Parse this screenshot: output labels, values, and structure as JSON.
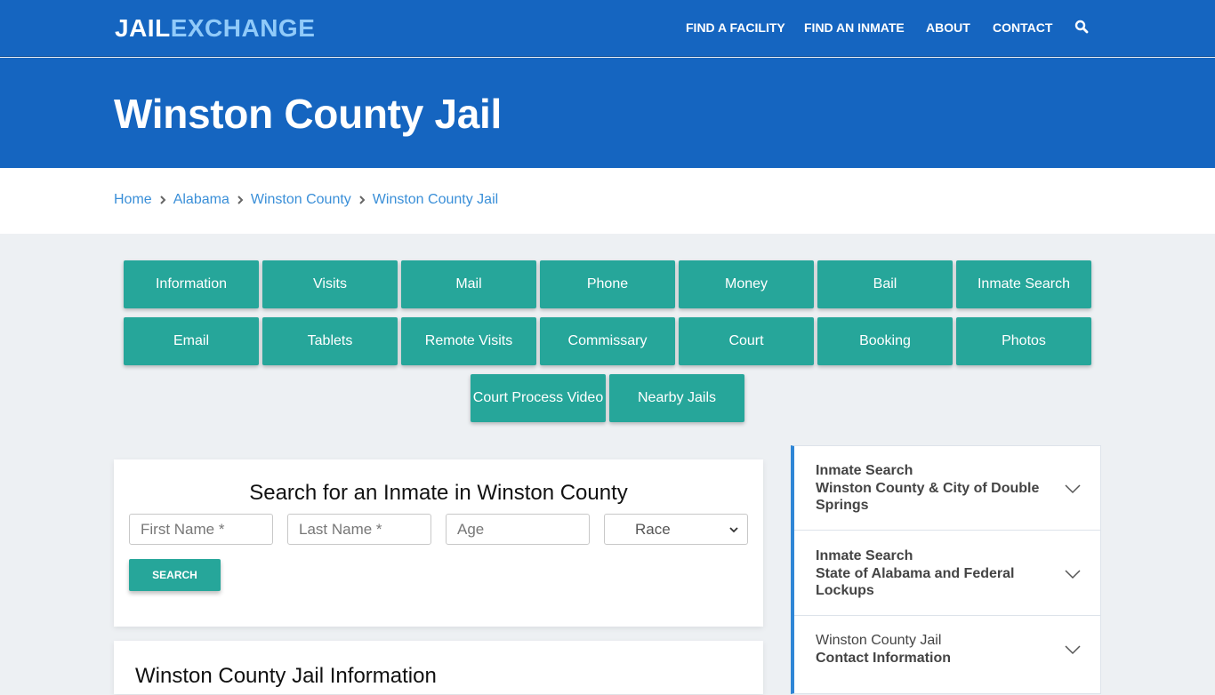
{
  "header": {
    "logo_part1": "JAIL",
    "logo_part2": "EXCHANGE",
    "nav": [
      {
        "label": "FIND A FACILITY"
      },
      {
        "label": "FIND AN INMATE"
      },
      {
        "label": "ABOUT"
      },
      {
        "label": "CONTACT"
      }
    ],
    "search_icon": "search-icon"
  },
  "hero": {
    "title": "Winston County Jail"
  },
  "breadcrumb": [
    {
      "label": "Home"
    },
    {
      "label": "Alabama"
    },
    {
      "label": "Winston County"
    },
    {
      "label": "Winston County Jail"
    }
  ],
  "tiles": [
    {
      "label": "Information"
    },
    {
      "label": "Visits"
    },
    {
      "label": "Mail"
    },
    {
      "label": "Phone"
    },
    {
      "label": "Money"
    },
    {
      "label": "Bail"
    },
    {
      "label": "Inmate Search"
    },
    {
      "label": "Email"
    },
    {
      "label": "Tablets"
    },
    {
      "label": "Remote Visits"
    },
    {
      "label": "Commissary"
    },
    {
      "label": "Court"
    },
    {
      "label": "Booking"
    },
    {
      "label": "Photos"
    },
    {
      "label": "Court Process Video"
    },
    {
      "label": "Nearby Jails"
    }
  ],
  "search": {
    "title": "Search for an Inmate in Winston County",
    "first_name_placeholder": "First Name *",
    "last_name_placeholder": "Last Name *",
    "age_placeholder": "Age",
    "race_selected": "Race",
    "button": "SEARCH"
  },
  "info": {
    "title": "Winston County Jail Information"
  },
  "sidebar": [
    {
      "line1": "Inmate Search",
      "line2": "Winston County & City of Double Springs"
    },
    {
      "line1": "Inmate Search",
      "line2": "State of Alabama and Federal Lockups"
    },
    {
      "line1": "Winston County Jail",
      "line2": "Contact Information"
    }
  ],
  "colors": {
    "brand_blue": "#1565c0",
    "logo_light": "#90caf9",
    "teal": "#26a69a",
    "link": "#3a8fd8",
    "accent_border": "#2f86d6"
  }
}
